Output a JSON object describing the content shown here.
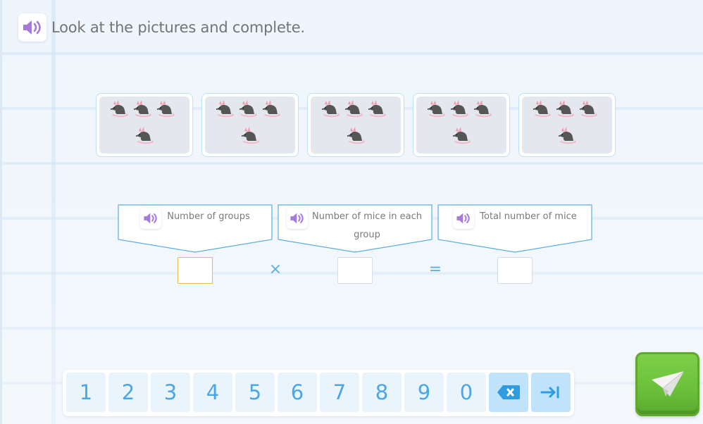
{
  "header": {
    "instruction": "Look at the pictures and complete.",
    "speaker_icon": "speaker-icon"
  },
  "colors": {
    "accent_blue": "#4aa6e6",
    "speaker_purple": "#a77ad8",
    "submit_green": "#6ac03a",
    "active_input_border": "#e8b84a",
    "card_border": "#bfe0f2"
  },
  "groups": [
    {
      "mice_count": 4
    },
    {
      "mice_count": 4
    },
    {
      "mice_count": 4
    },
    {
      "mice_count": 4
    },
    {
      "mice_count": 4
    }
  ],
  "equation": {
    "labels": [
      {
        "text": "Number of groups"
      },
      {
        "text": "Number of mice in each group"
      },
      {
        "text": "Total number of mice"
      }
    ],
    "answers": [
      {
        "value": "",
        "active": true
      },
      {
        "value": "",
        "active": false
      },
      {
        "value": "",
        "active": false
      }
    ],
    "operators": [
      "×",
      "="
    ]
  },
  "keypad": {
    "keys": [
      "1",
      "2",
      "3",
      "4",
      "5",
      "6",
      "7",
      "8",
      "9",
      "0"
    ],
    "backspace_icon": "backspace-icon",
    "next_icon": "tab-next-icon"
  },
  "submit": {
    "icon": "paper-plane-icon"
  }
}
